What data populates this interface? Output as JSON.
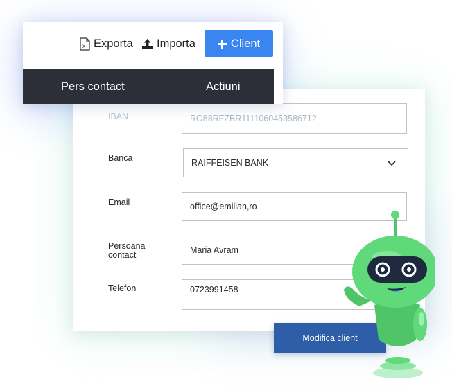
{
  "toolbar": {
    "export_label": "Exporta",
    "export_icon": "excel-file-icon",
    "import_label": "Importa",
    "import_icon": "upload-icon",
    "add_label": "Client",
    "add_icon": "plus-icon",
    "accent_color": "#3a86f0"
  },
  "table": {
    "columns": [
      "Pers contact",
      "Actiuni"
    ],
    "header_color": "#2d2f38"
  },
  "form": {
    "fields": [
      {
        "label": "IBAN",
        "value": "RO88RFZBR1111060453586712"
      },
      {
        "label": "Banca",
        "value": "RAIFFEISEN BANK"
      },
      {
        "label": "Email",
        "value": "office@emilian,ro"
      },
      {
        "label": "Persoana contact",
        "value": "Maria Avram"
      },
      {
        "label": "Telefon",
        "value": "0723991458"
      }
    ],
    "submit_label": "Modifica client",
    "submit_color": "#2f5ea8"
  },
  "mascot": {
    "icon": "robot-mascot-icon",
    "color": "#5fd97a"
  }
}
